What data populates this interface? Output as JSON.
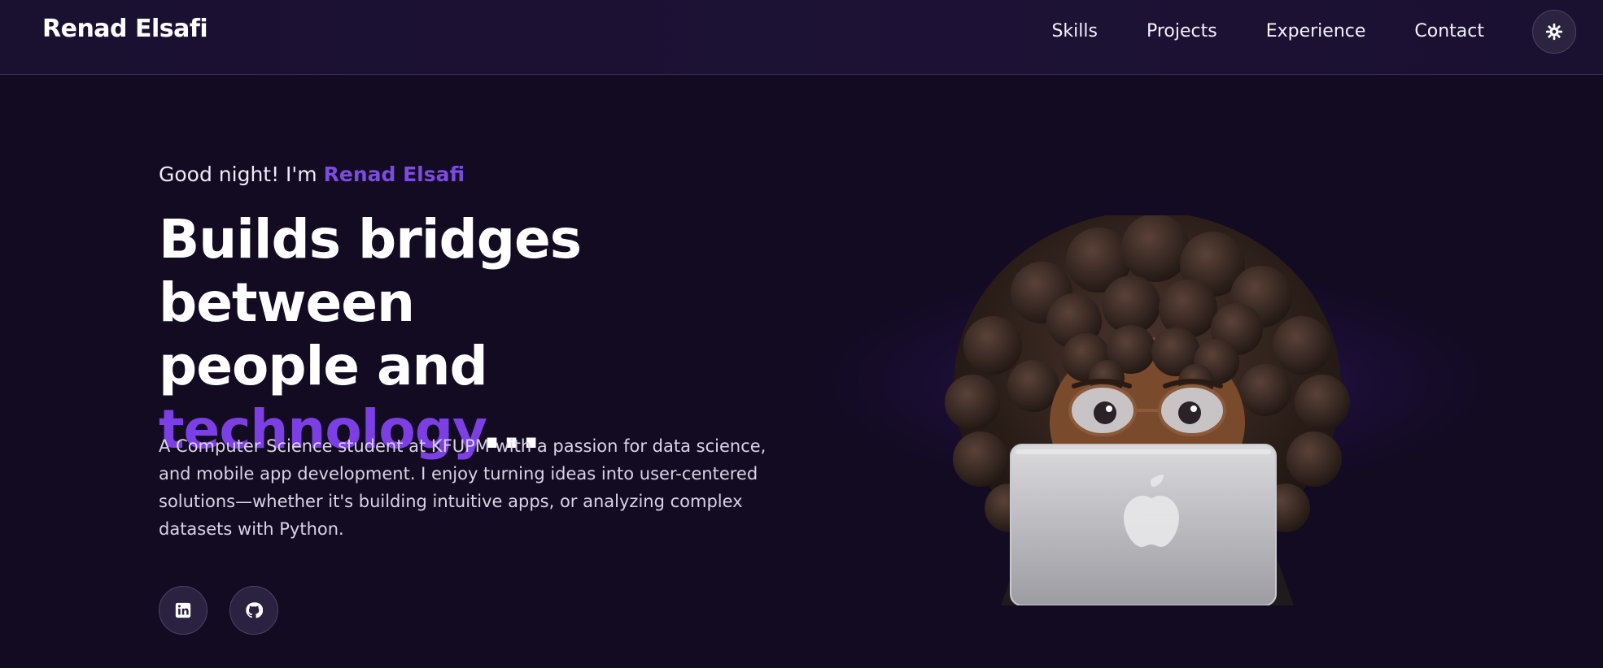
{
  "nav": {
    "brand": "Renad Elsafi",
    "links": [
      {
        "label": "Skills"
      },
      {
        "label": "Projects"
      },
      {
        "label": "Experience"
      },
      {
        "label": "Contact"
      }
    ],
    "theme_toggle_icon": "sun-gear-icon"
  },
  "hero": {
    "greeting_prefix": "Good night! I'm ",
    "greeting_name": "Renad Elsafi",
    "headline_line1": "Builds bridges between",
    "headline_line2": "people and",
    "headline_accent": "technology",
    "headline_suffix": "...",
    "description": "A Computer Science student at KFUPM with a passion for data science, and mobile app development. I enjoy turning ideas into user-centered solutions—whether it's building intuitive apps, or analyzing complex datasets with Python.",
    "socials": [
      {
        "icon": "linkedin-icon"
      },
      {
        "icon": "github-icon"
      }
    ],
    "avatar_icon": "memoji-laptop-avatar"
  },
  "colors": {
    "accent": "#7c3fe4",
    "background": "#120b22"
  }
}
